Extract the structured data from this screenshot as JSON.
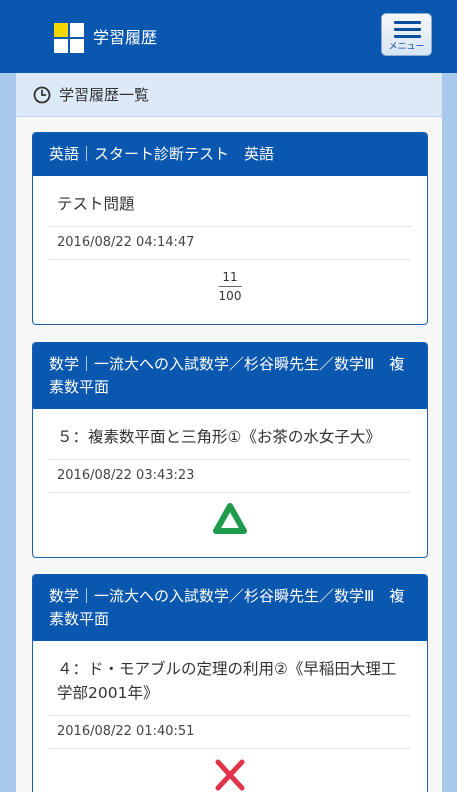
{
  "header": {
    "title": "学習履歴",
    "menu_label": "メニュー"
  },
  "subheader": {
    "title": "学習履歴一覧"
  },
  "history": [
    {
      "course": "英語｜スタート診断テスト　英語",
      "lesson": "テスト問題",
      "timestamp": "2016/08/22 04:14:47",
      "result_type": "score",
      "score_numerator": "11",
      "score_denominator": "100"
    },
    {
      "course": "数学｜一流大への入試数学／杉谷瞬先生／数学Ⅲ　複素数平面",
      "lesson": "５：複素数平面と三角形①《お茶の水女子大》",
      "timestamp": "2016/08/22 03:43:23",
      "result_type": "triangle-icon"
    },
    {
      "course": "数学｜一流大への入試数学／杉谷瞬先生／数学Ⅲ　複素数平面",
      "lesson": "４：ド・モアブルの定理の利用②《早稲田大理工学部2001年》",
      "timestamp": "2016/08/22 01:40:51",
      "result_type": "cross-icon"
    }
  ],
  "colors": {
    "header_bg": "#0a57b0",
    "logo_yellow": "#f4d800",
    "triangle_green": "#1e9a4c",
    "cross_red": "#e0344a"
  }
}
